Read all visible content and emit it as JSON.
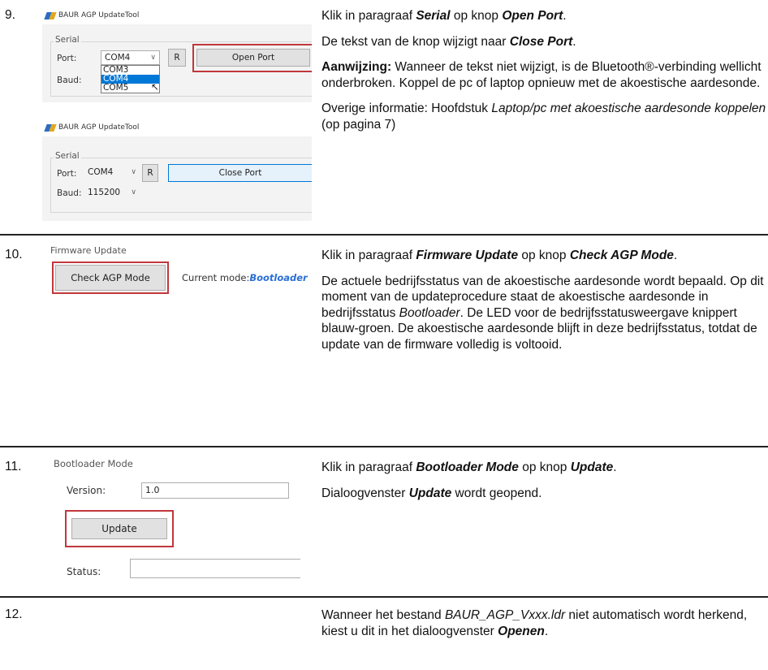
{
  "steps": [
    {
      "number": "9.",
      "shot_a": {
        "title": "BAUR AGP UpdateTool",
        "group": "Serial",
        "port_label": "Port:",
        "baud_label": "Baud:",
        "port_value": "COM4",
        "r_button": "R",
        "open_button": "Open Port",
        "dropdown_options": [
          "COM3",
          "COM4",
          "COM5"
        ],
        "dropdown_selected": "COM4"
      },
      "shot_b": {
        "title": "BAUR AGP UpdateTool",
        "group": "Serial",
        "port_label": "Port:",
        "baud_label": "Baud:",
        "port_value": "COM4",
        "baud_value": "115200",
        "r_button": "R",
        "close_button": "Close Port"
      },
      "p1_pre": "Klik in paragraaf ",
      "p1_b1": "Serial",
      "p1_mid": " op knop ",
      "p1_b2": "Open Port",
      "p1_end": ".",
      "p2_pre": "De tekst van de knop wijzigt naar ",
      "p2_b": "Close Port",
      "p2_end": ".",
      "p3_b": "Aanwijzing:",
      "p3_rest": " Wanneer de tekst niet wijzigt, is de Bluetooth®-verbinding wellicht onderbroken. Koppel de pc of laptop opnieuw met de akoestische aardesonde.",
      "p4_pre": "Overige informatie: Hoofdstuk ",
      "p4_i": "Laptop/pc met akoestische aardesonde koppelen",
      "p4_end": " (op pagina 7)"
    },
    {
      "number": "10.",
      "shot": {
        "group": "Firmware Update",
        "button": "Check AGP Mode",
        "mode_label": "Current mode:",
        "mode_value": "Bootloader"
      },
      "p1_pre": "Klik in paragraaf ",
      "p1_b1": "Firmware Update",
      "p1_mid": " op knop ",
      "p1_b2": "Check AGP Mode",
      "p1_end": ".",
      "p2_pre": "De actuele bedrijfsstatus van de akoestische aardesonde wordt bepaald. Op dit moment van de updateprocedure staat de akoestische aardesonde in bedrijfsstatus ",
      "p2_i": "Bootloader",
      "p2_rest": ". De LED voor de bedrijfsstatusweergave knippert blauw-groen. De akoestische aardesonde blijft in deze bedrijfsstatus, totdat de update van de firmware volledig is voltooid."
    },
    {
      "number": "11.",
      "shot": {
        "group": "Bootloader Mode",
        "version_label": "Version:",
        "version_value": "1.0",
        "button": "Update",
        "status_label": "Status:"
      },
      "p1_pre": "Klik in paragraaf ",
      "p1_b1": "Bootloader Mode",
      "p1_mid": " op knop ",
      "p1_b2": "Update",
      "p1_end": ".",
      "p2_pre": "Dialoogvenster ",
      "p2_b": "Update",
      "p2_end": " wordt geopend."
    },
    {
      "number": "12.",
      "p1_pre": "Wanneer het bestand ",
      "p1_i": "BAUR_AGP_Vxxx.ldr",
      "p1_mid": " niet automatisch wordt herkend, kiest u dit in het dialoogvenster ",
      "p1_b": "Openen",
      "p1_end": "."
    }
  ]
}
